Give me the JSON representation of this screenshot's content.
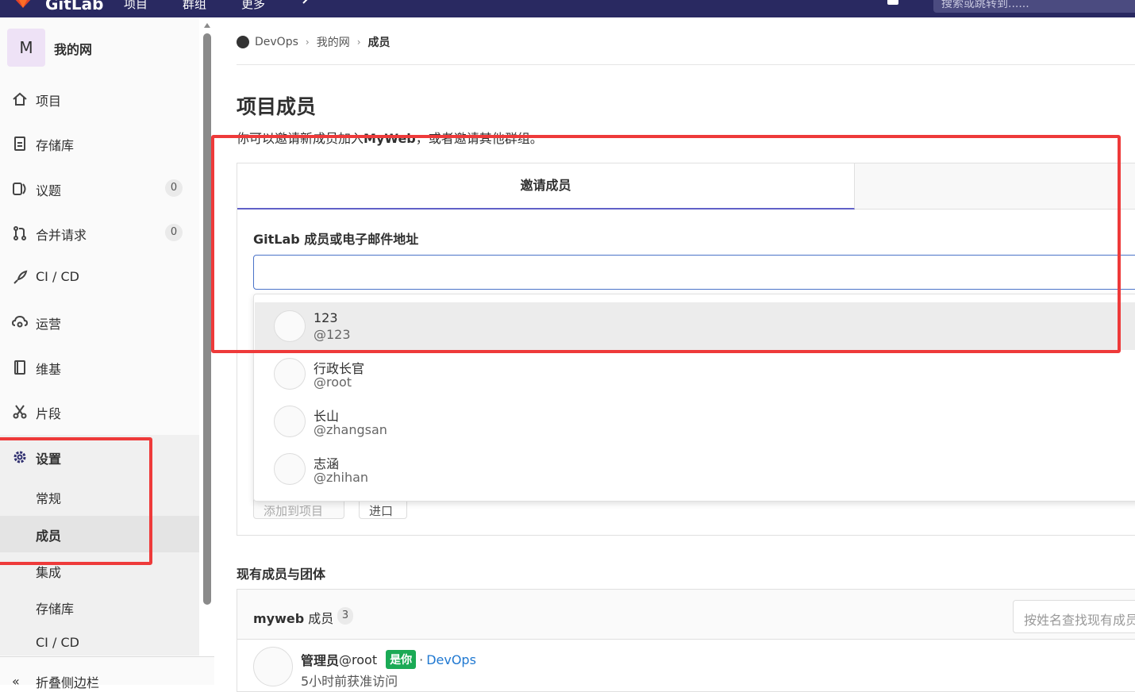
{
  "topbar": {
    "brand": "GitLab",
    "nav": [
      "项目",
      "群组",
      "更多"
    ],
    "search_placeholder": "搜索或跳转到......"
  },
  "sidebar": {
    "project_initial": "M",
    "project_name": "我的网",
    "items": [
      {
        "label": "项目",
        "icon": "home-icon"
      },
      {
        "label": "存储库",
        "icon": "document-icon"
      },
      {
        "label": "议题",
        "icon": "issues-icon",
        "count": "0"
      },
      {
        "label": "合并请求",
        "icon": "merge-request-icon",
        "count": "0"
      },
      {
        "label": "CI / CD",
        "icon": "rocket-icon"
      },
      {
        "label": "运营",
        "icon": "cloud-gear-icon"
      },
      {
        "label": "维基",
        "icon": "book-icon"
      },
      {
        "label": "片段",
        "icon": "scissors-icon"
      }
    ],
    "settings": {
      "label": "设置",
      "sub_items": [
        "常规",
        "成员",
        "集成",
        "存储库",
        "CI / CD"
      ]
    },
    "collapse_label": "折叠侧边栏"
  },
  "breadcrumb": {
    "group": "DevOps",
    "project": "我的网",
    "current": "成员"
  },
  "page": {
    "title": "项目成员",
    "intro_before": "你可以邀请新成员加入",
    "intro_project": "MyWeb",
    "intro_after": "，或者邀请其他群组。"
  },
  "invite": {
    "tab_label": "邀请成员",
    "field_label": "GitLab 成员或电子邮件地址",
    "input_value": "",
    "suggestions": [
      {
        "name": "123",
        "username": "@123"
      },
      {
        "name": "行政长官",
        "username": "@root"
      },
      {
        "name": "长山",
        "username": "@zhangsan"
      },
      {
        "name": "志涵",
        "username": "@zhihan"
      }
    ],
    "add_button": "添加到项目",
    "import_button": "进口"
  },
  "members": {
    "section_title": "现有成员与团体",
    "project": "myweb",
    "label": "成员",
    "count": "3",
    "filter_placeholder": "按姓名查找现有成员",
    "list": [
      {
        "name": "管理员",
        "username": "@root",
        "badge": "是你",
        "group": "DevOps",
        "access": "5小时前获准访问"
      }
    ]
  },
  "colors": {
    "topbar": "#292961",
    "accent": "#6060c8",
    "highlight": "#ee3a3a",
    "badge": "#1aaa55",
    "link": "#1f78d1"
  }
}
